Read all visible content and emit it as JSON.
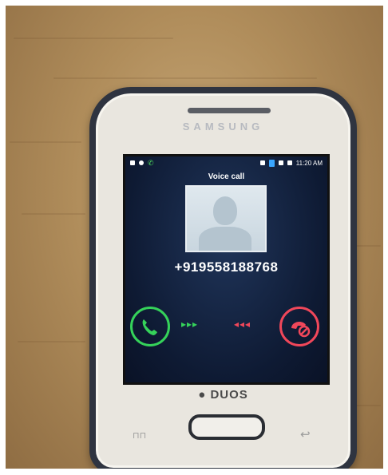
{
  "phone": {
    "brand": "SAMSUNG",
    "model_label": "DUOS",
    "menu_key": "⊓⊓",
    "back_key": "↩"
  },
  "screen": {
    "status_time": "11:20 AM",
    "call_label": "Voice call",
    "number": "+919558188768",
    "accept_arrows": "▸▸▸",
    "reject_arrows": "◂◂◂",
    "accept_icon": "phone-accept-icon",
    "reject_icon": "phone-reject-icon"
  },
  "colors": {
    "accept": "#35d25a",
    "reject": "#f0475a",
    "screen_bg": "#0e1a33"
  }
}
